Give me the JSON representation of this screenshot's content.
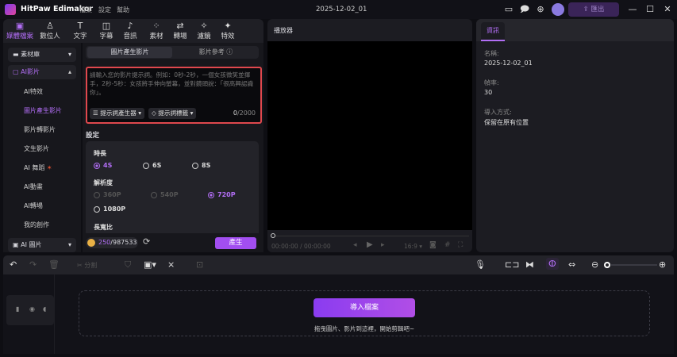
{
  "app": {
    "name": "HitPaw Edimakor",
    "menu": [
      "檔案",
      "設定",
      "幫助"
    ],
    "doc_title": "2025-12-02_01",
    "export_label": "匯出"
  },
  "tool_tabs": [
    {
      "label": "媒體檔案",
      "icon": "media-icon",
      "active": true
    },
    {
      "label": "數位人",
      "icon": "avatar-person-icon"
    },
    {
      "label": "文字",
      "icon": "text-icon"
    },
    {
      "label": "字幕",
      "icon": "subtitle-icon"
    },
    {
      "label": "音訊",
      "icon": "music-icon"
    },
    {
      "label": "素材",
      "icon": "elements-icon"
    },
    {
      "label": "轉場",
      "icon": "transition-icon"
    },
    {
      "label": "濾鏡",
      "icon": "filter-icon"
    },
    {
      "label": "特效",
      "icon": "effects-icon"
    }
  ],
  "sidebar": {
    "library": "素材庫",
    "ai_video": "AI影片",
    "items": [
      "AI特效",
      "圖片產生影片",
      "影片轉影片",
      "文生影片",
      "AI 舞蹈",
      "AI動畫",
      "AI轉場",
      "我的創作"
    ],
    "active_item": "圖片產生影片",
    "ai_image": "AI 圖片"
  },
  "content": {
    "tabs": [
      "圖片產生影片",
      "影片參考"
    ],
    "prompt_placeholder": "請輸入您的影片提示詞。例如：0秒-2秒，一個女孩微笑並揮手，2秒-5秒：女孩將手伸向螢幕，並對鏡頭說：「很高興認識你」。",
    "prompt_generator": "提示詞產生器",
    "prompt_tags": "提示詞標籤",
    "char_count": "0",
    "char_max": "/2000",
    "settings_label": "設定",
    "duration": {
      "label": "時長",
      "options": [
        "4S",
        "6S",
        "8S"
      ],
      "selected": "4S"
    },
    "resolution": {
      "label": "解析度",
      "options": [
        "360P",
        "540P",
        "720P",
        "1080P"
      ],
      "selected": "720P",
      "disabled": [
        "360P",
        "540P"
      ]
    },
    "aspect_label": "長寬比",
    "credits_used": "250",
    "credits_total": "/987533",
    "generate": "產生"
  },
  "player": {
    "title": "播放器",
    "time": "00:00:00 / 00:00:00",
    "ratio": "16:9"
  },
  "info": {
    "tab": "資訊",
    "name_label": "名稱:",
    "name": "2025-12-02_01",
    "fps_label": "幀率:",
    "fps": "30",
    "import_label": "導入方式:",
    "import_mode": "保留在原有位置"
  },
  "timeline": {
    "split": "分割",
    "import_button": "導入檔案",
    "hint": "拖曳圖片、影片到這裡，開始剪輯吧~"
  },
  "colors": {
    "accent": "#a24ef0",
    "highlight_border": "#e0484e"
  }
}
